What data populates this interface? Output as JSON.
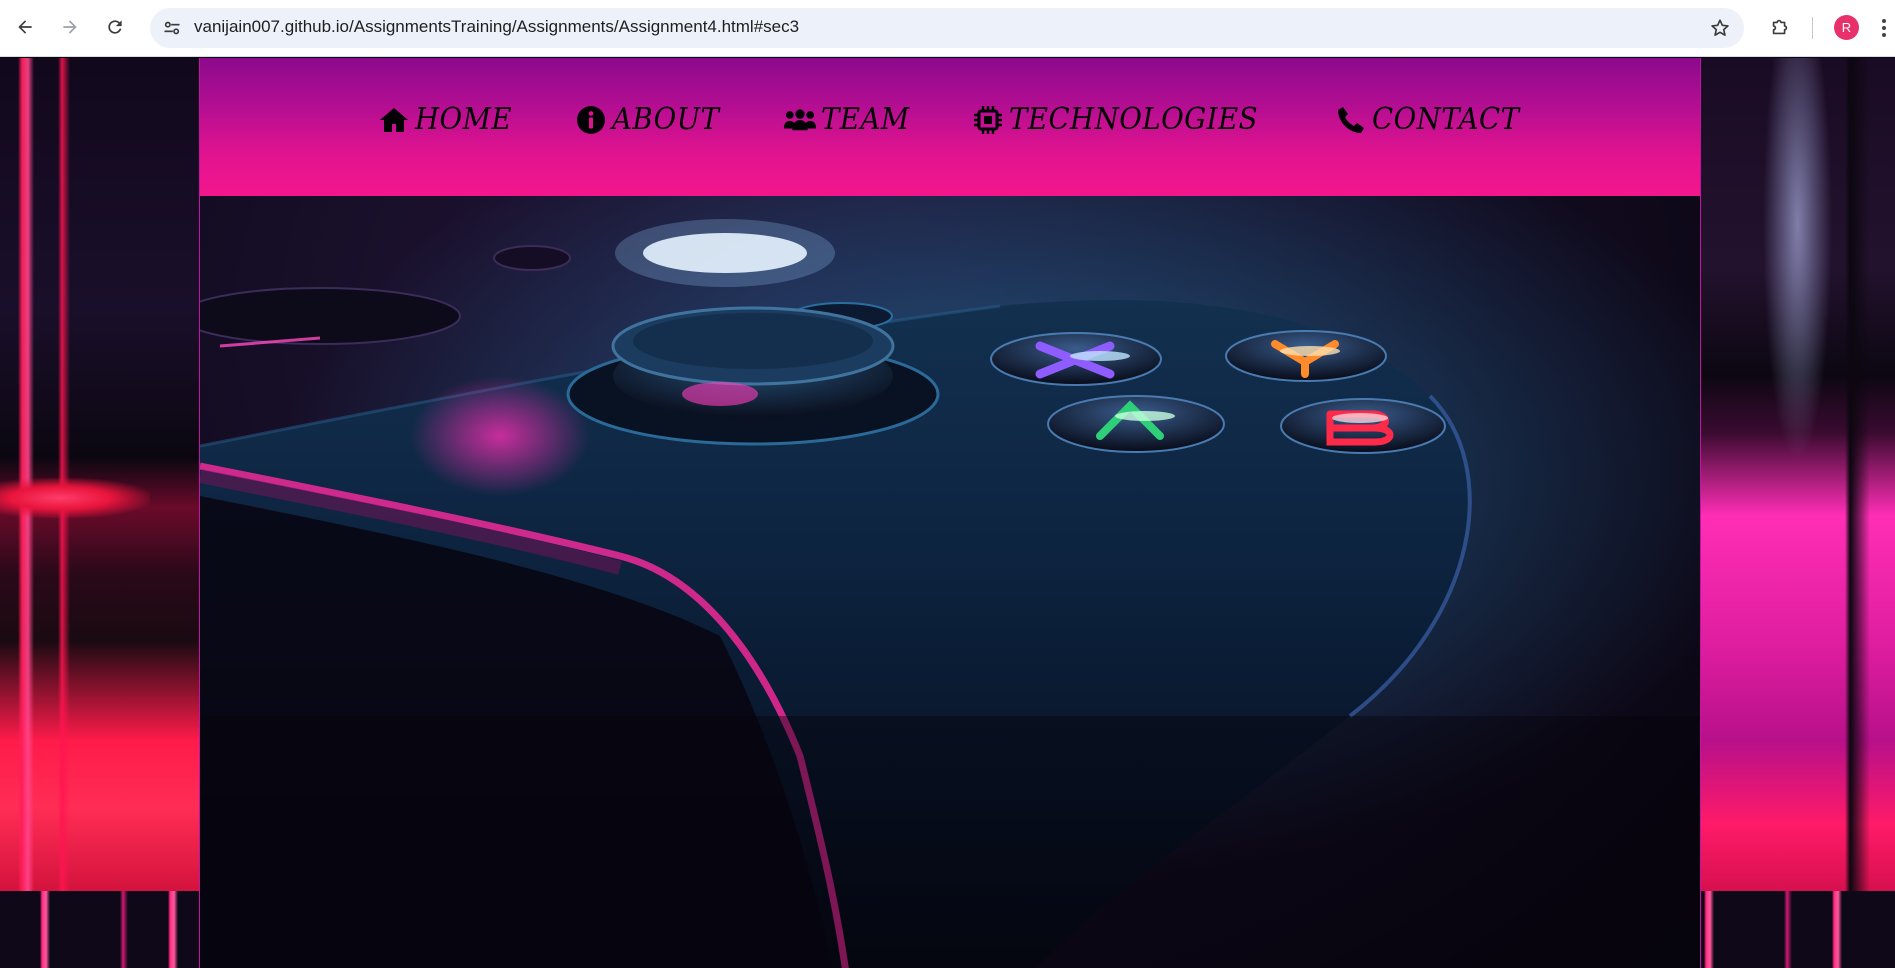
{
  "browser": {
    "url": "vanijain007.github.io/AssignmentsTraining/Assignments/Assignment4.html#sec3",
    "profile_initial": "R",
    "icons": {
      "back": "arrow-left-icon",
      "forward": "arrow-right-icon",
      "reload": "reload-icon",
      "site_info": "tune-icon",
      "bookmark": "star-icon",
      "extensions": "puzzle-icon",
      "menu": "kebab-menu-icon"
    }
  },
  "site": {
    "nav": [
      {
        "label": "HOME",
        "icon": "home-icon"
      },
      {
        "label": "ABOUT",
        "icon": "info-circle-icon"
      },
      {
        "label": "TEAM",
        "icon": "users-icon"
      },
      {
        "label": "TECHNOLOGIES",
        "icon": "microchip-icon"
      },
      {
        "label": "CONTACT",
        "icon": "phone-icon"
      }
    ],
    "colors": {
      "header_top": "#8c0a8c",
      "header_bottom": "#f3168c",
      "nav_text": "#050005",
      "frame_border": "#c214a0",
      "avatar": "#e8306a"
    },
    "hero_image": "game-controller-neon-photo"
  }
}
